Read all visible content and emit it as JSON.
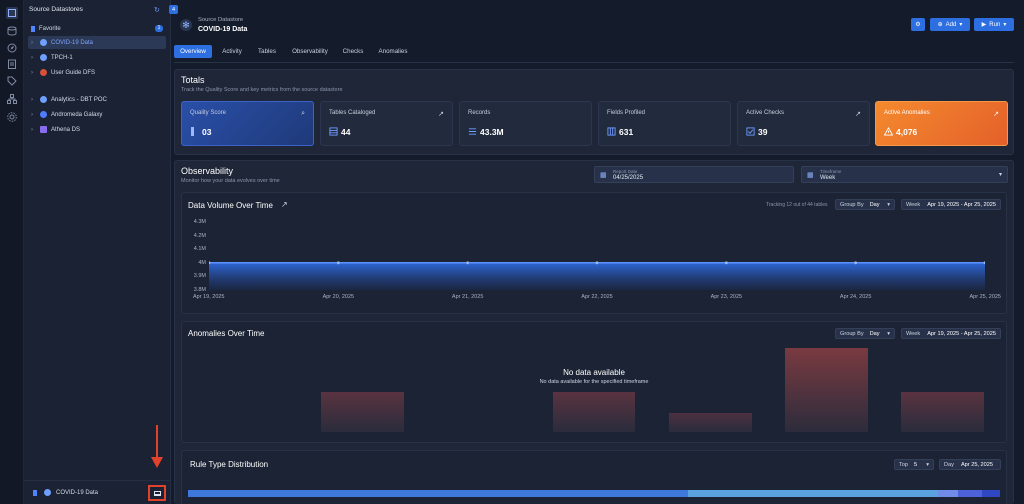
{
  "sidebar": {
    "title": "Source Datastores",
    "badge": "4",
    "favorite_label": "Favorite",
    "favorite_count": "1",
    "items": [
      {
        "label": "COVID-19 Data",
        "selected": true,
        "color": "#6fa0ff"
      },
      {
        "label": "TPCH-1",
        "selected": false,
        "color": "#6fa0ff"
      },
      {
        "label": "User Guide DFS",
        "selected": false,
        "color": "#d6503a"
      },
      {
        "label": "Analytics - DBT POC",
        "selected": false,
        "color": "#6fa0ff"
      },
      {
        "label": "Andromeda Galaxy",
        "selected": false,
        "color": "#4f7cff"
      },
      {
        "label": "Athena DS",
        "selected": false,
        "color": "#8a6cf0"
      }
    ],
    "footer_label": "COVID-19 Data"
  },
  "header": {
    "subtitle": "Source Datastore",
    "title": "COVID-19 Data",
    "add_label": "Add",
    "run_label": "Run"
  },
  "tabs": [
    "Overview",
    "Activity",
    "Tables",
    "Observability",
    "Checks",
    "Anomalies"
  ],
  "active_tab": 0,
  "totals": {
    "title": "Totals",
    "subtitle": "Track the Quality Score and key metrics from the source datastore",
    "cards": [
      {
        "label": "Quality Score",
        "value": "03",
        "icon": "search-icon"
      },
      {
        "label": "Tables Cataloged",
        "value": "44",
        "icon": "table-icon"
      },
      {
        "label": "Records",
        "value": "43.3M",
        "icon": "records-icon"
      },
      {
        "label": "Fields Profiled",
        "value": "631",
        "icon": "fields-icon"
      },
      {
        "label": "Active Checks",
        "value": "39",
        "icon": "check-icon"
      },
      {
        "label": "Active Anomalies",
        "value": "4,076",
        "icon": "warning-icon"
      }
    ]
  },
  "observability": {
    "title": "Observability",
    "subtitle": "Monitor how your data evolves over time",
    "report_date_label": "Report Date",
    "report_date": "04/25/2025",
    "timeframe_label": "Timeframe",
    "timeframe": "Week"
  },
  "volume": {
    "title": "Data Volume Over Time",
    "tracking": "Tracking 12 out of 44 tables",
    "group_by_label": "Group By",
    "group_by": "Day",
    "week_label": "Week",
    "range": "Apr 19, 2025 - Apr 25, 2025"
  },
  "anomalies": {
    "title": "Anomalies Over Time",
    "group_by_label": "Group By",
    "group_by": "Day",
    "week_label": "Week",
    "range": "Apr 19, 2025 - Apr 25, 2025",
    "empty_title": "No data available",
    "empty_subtitle": "No data available for the specified timeframe"
  },
  "rule_dist": {
    "title": "Rule Type Distribution",
    "top_label": "Top",
    "top_value": "5",
    "day_label": "Day",
    "date": "Apr 25, 2025"
  },
  "chart_data": {
    "type": "area",
    "x": [
      "Apr 19, 2025",
      "Apr 20, 2025",
      "Apr 21, 2025",
      "Apr 22, 2025",
      "Apr 23, 2025",
      "Apr 24, 2025",
      "Apr 25, 2025"
    ],
    "y_ticks": [
      "4.3M",
      "4.2M",
      "4.1M",
      "4M",
      "3.9M",
      "3.8M"
    ],
    "values": [
      4000000,
      4000000,
      4000000,
      4000000,
      4000000,
      4000000,
      4000000
    ],
    "ylim": [
      3800000,
      4300000
    ]
  },
  "colors": {
    "accent": "#2d6fe0",
    "anomaly_card": "#f07a2a"
  }
}
